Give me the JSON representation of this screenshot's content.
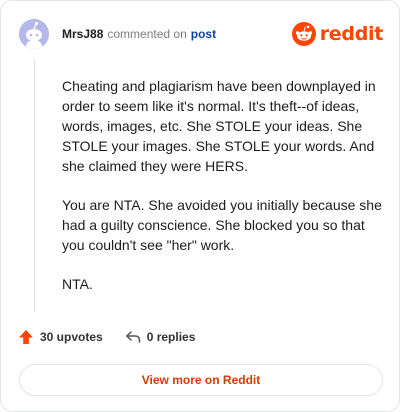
{
  "comment": {
    "username": "MrsJ88",
    "action_text": "commented on",
    "post_link": "post",
    "paragraphs": [
      "Cheating and plagiarism have been downplayed in order to seem like it's normal. It's theft--of ideas, words, images, etc. She STOLE your ideas. She STOLE your images. She STOLE your words. And she claimed they were HERS.",
      "You are NTA. She avoided you initially because she had a guilty conscience. She blocked you so that you couldn't see \"her\" work.",
      "NTA."
    ]
  },
  "brand": {
    "wordmark": "reddit",
    "color": "#ff4500"
  },
  "actions": {
    "upvotes_label": "30 upvotes",
    "replies_label": "0 replies",
    "upvote_icon": "upvote-arrow-icon",
    "reply_icon": "reply-arrow-icon"
  },
  "footer": {
    "view_more_label": "View more on Reddit"
  },
  "colors": {
    "accent": "#ff4500",
    "link": "#0a449b",
    "button_text": "#d93a00"
  }
}
